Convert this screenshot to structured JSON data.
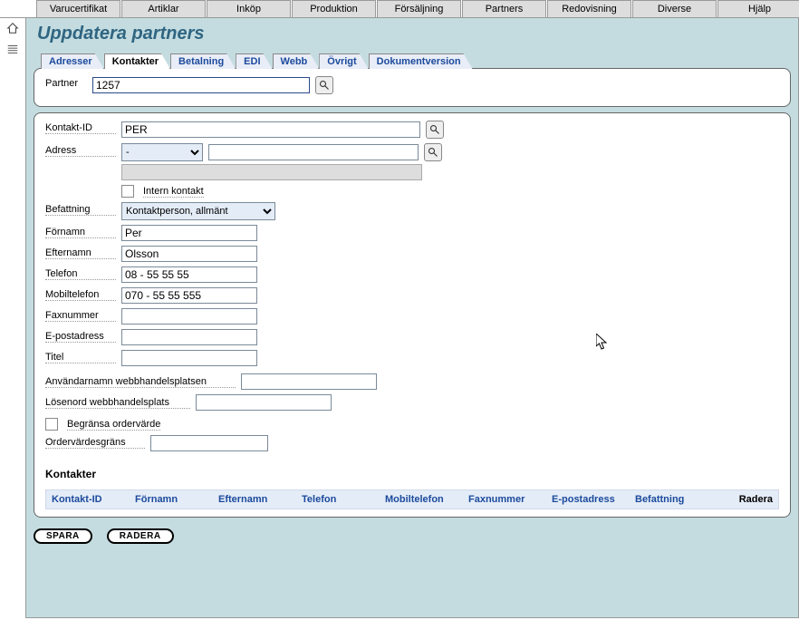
{
  "main_menu": [
    "Varucertifikat",
    "Artiklar",
    "Inköp",
    "Produktion",
    "Försäljning",
    "Partners",
    "Redovisning",
    "Diverse",
    "Hjälp"
  ],
  "page_title": "Uppdatera partners",
  "subtabs": [
    "Adresser",
    "Kontakter",
    "Betalning",
    "EDI",
    "Webb",
    "Övrigt",
    "Dokumentversion"
  ],
  "active_subtab": 1,
  "partner": {
    "label": "Partner",
    "value": "1257"
  },
  "form": {
    "kontakt_id": {
      "label": "Kontakt-ID",
      "value": "PER"
    },
    "adress": {
      "label": "Adress",
      "select_value": "-",
      "text_value": ""
    },
    "intern_kontakt_label": "Intern kontakt",
    "befattning": {
      "label": "Befattning",
      "value": "Kontaktperson, allmänt"
    },
    "fornamn": {
      "label": "Förnamn",
      "value": "Per"
    },
    "efternamn": {
      "label": "Efternamn",
      "value": "Olsson"
    },
    "telefon": {
      "label": "Telefon",
      "value": "08 - 55 55 55"
    },
    "mobil": {
      "label": "Mobiltelefon",
      "value": "070 - 55 55 555"
    },
    "fax": {
      "label": "Faxnummer",
      "value": ""
    },
    "epost": {
      "label": "E-postadress",
      "value": ""
    },
    "titel": {
      "label": "Titel",
      "value": ""
    },
    "web_user": {
      "label": "Användarnamn webbhandelsplatsen",
      "value": ""
    },
    "web_pass": {
      "label": "Lösenord webbhandelsplats",
      "value": ""
    },
    "begransa_label": "Begränsa ordervärde",
    "ordervarde": {
      "label": "Ordervärdesgräns",
      "value": ""
    }
  },
  "section_title": "Kontakter",
  "table_headers": [
    "Kontakt-ID",
    "Förnamn",
    "Efternamn",
    "Telefon",
    "Mobiltelefon",
    "Faxnummer",
    "E-postadress",
    "Befattning",
    "Radera"
  ],
  "actions": {
    "save": "SPARA",
    "delete": "RADERA"
  }
}
